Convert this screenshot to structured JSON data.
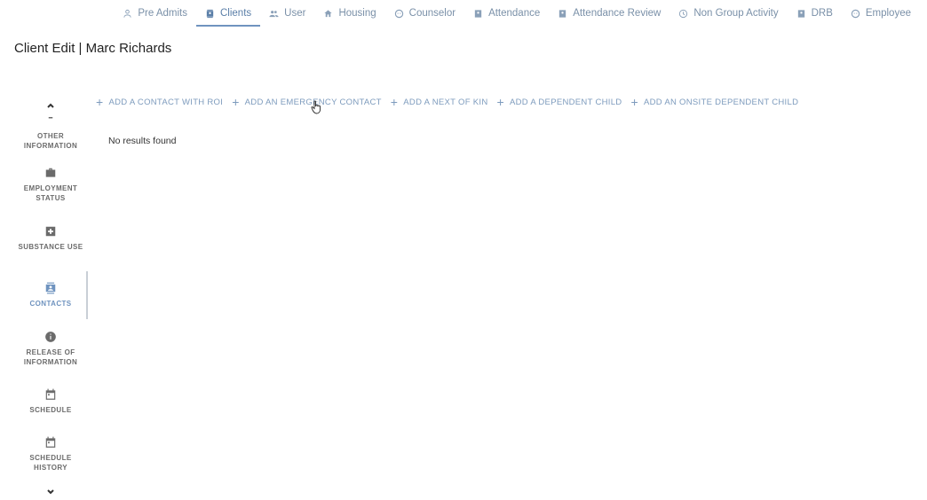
{
  "nav": {
    "items": [
      {
        "label": "Pre Admits",
        "icon": "person-icon"
      },
      {
        "label": "Clients",
        "icon": "contact-icon",
        "active": true
      },
      {
        "label": "User",
        "icon": "group-icon"
      },
      {
        "label": "Housing",
        "icon": "home-icon"
      },
      {
        "label": "Counselor",
        "icon": "face-icon"
      },
      {
        "label": "Attendance",
        "icon": "badge-icon"
      },
      {
        "label": "Attendance Review",
        "icon": "badge-icon"
      },
      {
        "label": "Non Group Activity",
        "icon": "clock-icon"
      },
      {
        "label": "DRB",
        "icon": "badge-icon"
      },
      {
        "label": "Employee",
        "icon": "face-icon"
      }
    ]
  },
  "page": {
    "title": "Client Edit | Marc Richards"
  },
  "sidebar": {
    "items": [
      {
        "label": "Other Information",
        "icon": "info-box-icon"
      },
      {
        "label": "Employment Status",
        "icon": "briefcase-icon"
      },
      {
        "label": "Substance Use",
        "icon": "medical-plus-icon"
      },
      {
        "label": "Contacts",
        "icon": "contact-icon",
        "active": true
      },
      {
        "label": "Release of Information",
        "icon": "info-icon"
      },
      {
        "label": "Schedule",
        "icon": "calendar-icon"
      },
      {
        "label": "Schedule History",
        "icon": "calendar-icon"
      }
    ]
  },
  "actions": {
    "items": [
      {
        "label": "Add a contact with ROI"
      },
      {
        "label": "Add an emergency contact"
      },
      {
        "label": "Add a next of kin"
      },
      {
        "label": "Add a dependent child"
      },
      {
        "label": "Add an onsite dependent child"
      }
    ]
  },
  "results": {
    "empty_text": "No results found"
  },
  "colors": {
    "accent": "#6f93bf",
    "nav_text": "#7a90a8",
    "sidebar_text": "#6b6b6b"
  }
}
